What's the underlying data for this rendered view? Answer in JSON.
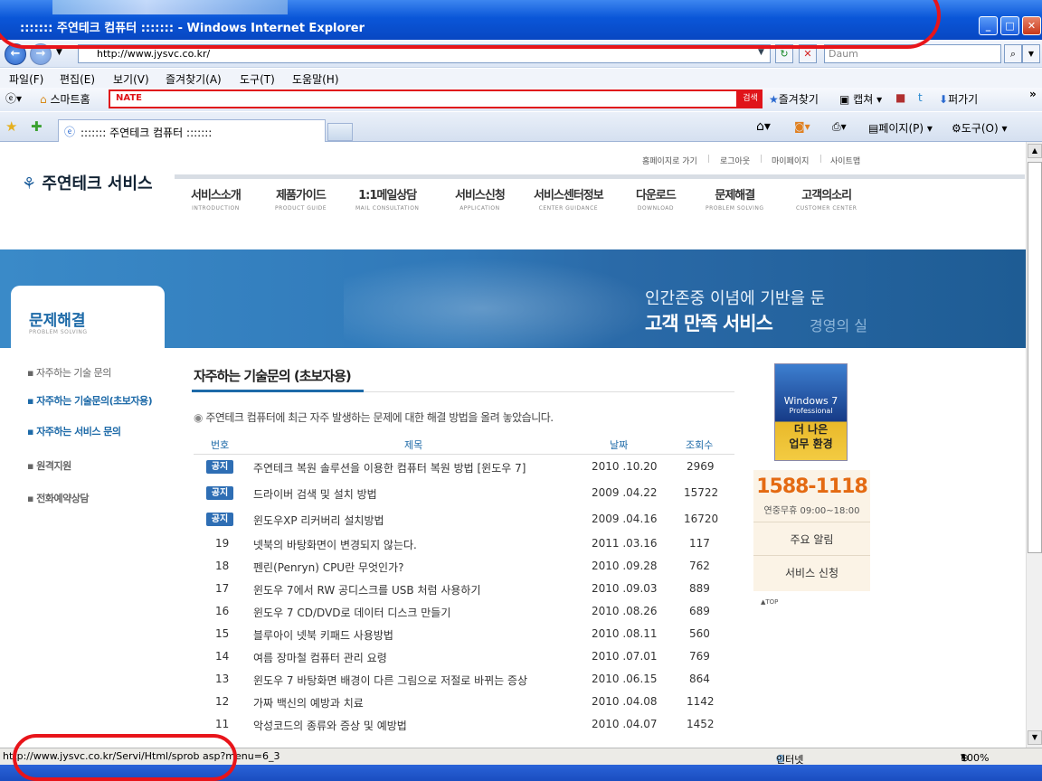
{
  "window": {
    "title": "::::::: 주연테크 컴퓨터 ::::::: - Windows Internet Explorer"
  },
  "address": {
    "url": "http://www.jysvc.co.kr/",
    "search_placeholder": "Daum"
  },
  "menu": [
    "파일(F)",
    "편집(E)",
    "보기(V)",
    "즐겨찾기(A)",
    "도구(T)",
    "도움말(H)"
  ],
  "toolbar": {
    "smart_home": "스마트홈",
    "nate": "NATE",
    "search_btn": "검색",
    "favorites": "즐겨찾기",
    "capture": "캡쳐",
    "share": "퍼가기"
  },
  "tab": {
    "title": "::::::: 주연테크 컴퓨터 :::::::",
    "page": "페이지(P)",
    "tools": "도구(O)"
  },
  "util": [
    "홈페이지로 가기",
    "로그아웃",
    "마이페이지",
    "사이트맵"
  ],
  "logo": "주연테크 서비스",
  "gnb": [
    {
      "k": "서비스소개",
      "e": "INTRODUCTION"
    },
    {
      "k": "제품가이드",
      "e": "PRODUCT GUIDE"
    },
    {
      "k": "1:1메일상담",
      "e": "MAIL CONSULTATION"
    },
    {
      "k": "서비스신청",
      "e": "APPLICATION"
    },
    {
      "k": "서비스센터정보",
      "e": "CENTER GUIDANCE"
    },
    {
      "k": "다운로드",
      "e": "DOWNLOAD"
    },
    {
      "k": "문제해결",
      "e": "PROBLEM SOLVING"
    },
    {
      "k": "고객의소리",
      "e": "CUSTOMER CENTER"
    }
  ],
  "banner": {
    "l1": "인간존중 이념에 기반을 둔",
    "l2": "고객 만족 서비스",
    "l3": "경영의 실"
  },
  "side": {
    "title": "문제해결",
    "sub": "PROBLEM SOLVING",
    "items": [
      "자주하는 기술 문의",
      "자주하는 기술문의(초보자용)",
      "자주하는 서비스 문의",
      "원격지원",
      "전화예약상담"
    ]
  },
  "main": {
    "title": "자주하는 기술문의 (초보자용)",
    "intro": "주연테크 컴퓨터에 최근 자주 발생하는 문제에 대한 해결 방법을 올려 놓았습니다."
  },
  "table": {
    "headers": [
      "번호",
      "제목",
      "날짜",
      "조회수"
    ],
    "rows": [
      {
        "no": "공지",
        "title": "주연테크 복원 솔루션을 이용한 컴퓨터 복원 방법 [윈도우 7]",
        "date": "2010 .10.20",
        "views": "2969"
      },
      {
        "no": "공지",
        "title": "드라이버 검색 및 설치 방법",
        "date": "2009 .04.22",
        "views": "15722"
      },
      {
        "no": "공지",
        "title": "윈도우XP 리커버리 설치방법",
        "date": "2009 .04.16",
        "views": "16720"
      },
      {
        "no": "19",
        "title": "넷북의 바탕화면이 변경되지 않는다.",
        "date": "2011 .03.16",
        "views": "117"
      },
      {
        "no": "18",
        "title": "펜린(Penryn) CPU란 무엇인가?",
        "date": "2010 .09.28",
        "views": "762"
      },
      {
        "no": "17",
        "title": "윈도우 7에서 RW 공디스크를 USB 처럼 사용하기",
        "date": "2010 .09.03",
        "views": "889"
      },
      {
        "no": "16",
        "title": "윈도우 7 CD/DVD로 데이터 디스크 만들기",
        "date": "2010 .08.26",
        "views": "689"
      },
      {
        "no": "15",
        "title": "블루아이 넷북 키패드 사용방법",
        "date": "2010 .08.11",
        "views": "560"
      },
      {
        "no": "14",
        "title": "여름 장마철 컴퓨터 관리 요령",
        "date": "2010 .07.01",
        "views": "769"
      },
      {
        "no": "13",
        "title": "윈도우 7 바탕화면 배경이 다른 그림으로 저절로 바뀌는 증상",
        "date": "2010 .06.15",
        "views": "864"
      },
      {
        "no": "12",
        "title": "가짜 백신의 예방과 치료",
        "date": "2010 .04.08",
        "views": "1142"
      },
      {
        "no": "11",
        "title": "악성코드의 종류와 증상 및 예방법",
        "date": "2010 .04.07",
        "views": "1452"
      }
    ]
  },
  "win7": {
    "l1": "Windows 7",
    "l2": "Professional",
    "l3": "더 나은",
    "l4": "업무 환경"
  },
  "quick": {
    "phone": "1588-1118",
    "hours": "연중무휴 09:00~18:00",
    "l1": "주요 알림",
    "l2": "서비스 신청",
    "top": "▲TOP"
  },
  "status": {
    "text": "http://www.jysvc.co.kr/Servi/Html/sprob asp?menu=6_3",
    "zone": "인터넷",
    "zoom": "100%"
  }
}
